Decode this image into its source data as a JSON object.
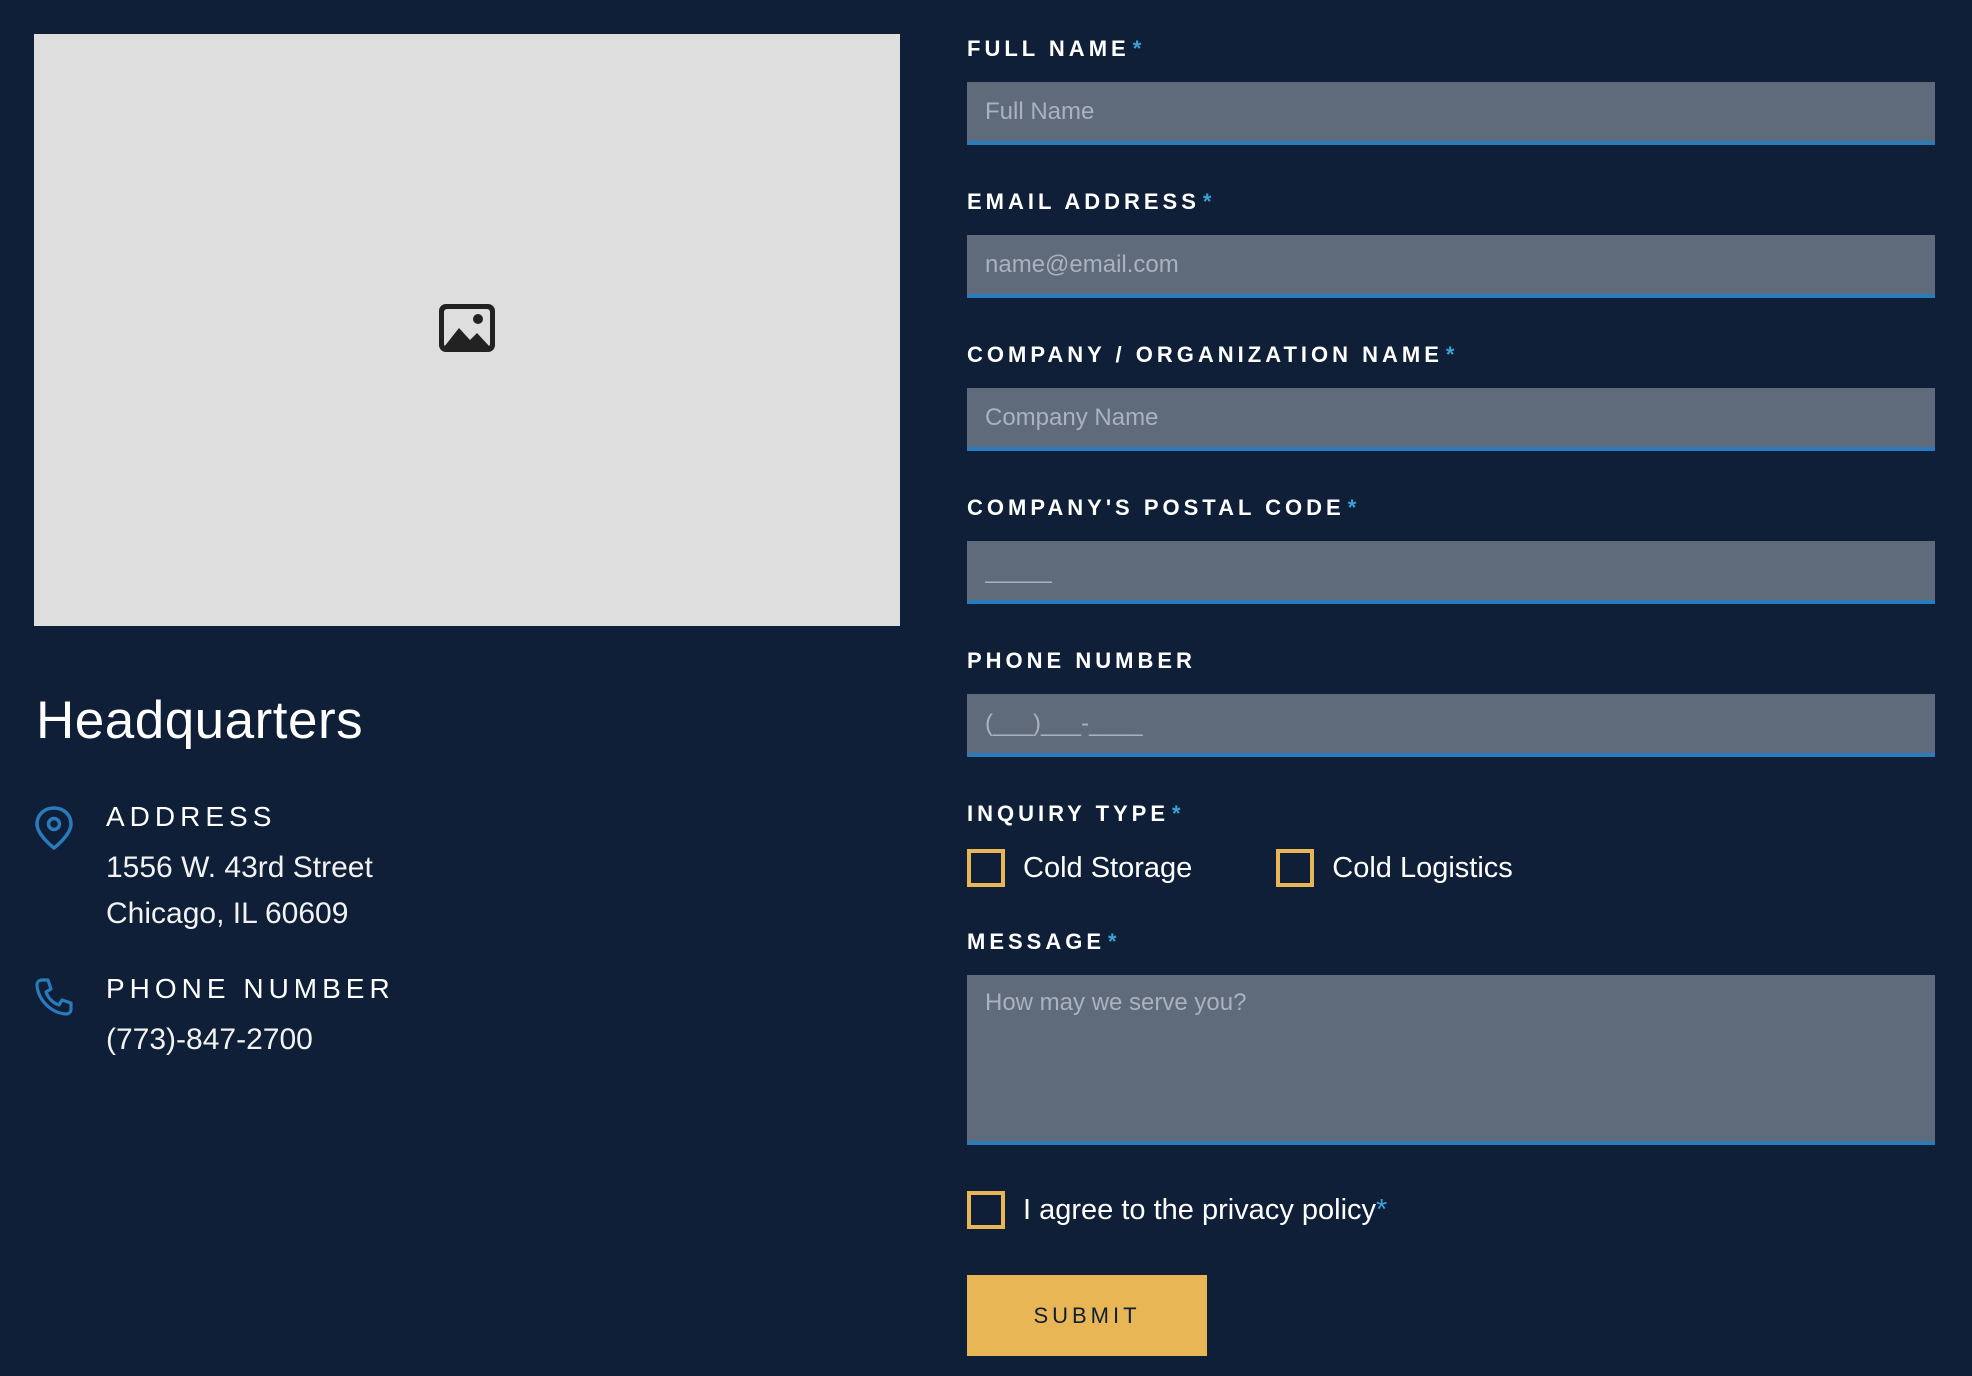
{
  "headquarters": {
    "title": "Headquarters",
    "address_label": "ADDRESS",
    "address_line1": "1556 W. 43rd Street",
    "address_line2": "Chicago, IL 60609",
    "phone_label": "PHONE NUMBER",
    "phone_value": "(773)-847-2700"
  },
  "form": {
    "full_name": {
      "label": "FULL NAME",
      "required": "*",
      "placeholder": "Full Name"
    },
    "email": {
      "label": "EMAIL ADDRESS",
      "required": "*",
      "placeholder": "name@email.com"
    },
    "company": {
      "label": "COMPANY / ORGANIZATION NAME",
      "required": "*",
      "placeholder": "Company Name"
    },
    "postal": {
      "label": "COMPANY'S POSTAL CODE",
      "required": "*",
      "placeholder": "_____"
    },
    "phone": {
      "label": "PHONE NUMBER",
      "placeholder": "(___)___-____"
    },
    "inquiry": {
      "label": "INQUIRY TYPE",
      "required": "*",
      "options": [
        "Cold Storage",
        "Cold Logistics"
      ]
    },
    "message": {
      "label": "MESSAGE",
      "required": "*",
      "placeholder": "How may we serve you?"
    },
    "privacy": {
      "text": "I agree to the privacy policy",
      "required": "*"
    },
    "submit_label": "SUBMIT"
  },
  "icons": {
    "image_placeholder": "image-icon",
    "address": "map-pin-icon",
    "phone": "phone-icon"
  },
  "colors": {
    "background": "#0e1f37",
    "accent_blue": "#2a7bbb",
    "accent_gold": "#e8b655",
    "input_bg": "#5f6b7a"
  }
}
